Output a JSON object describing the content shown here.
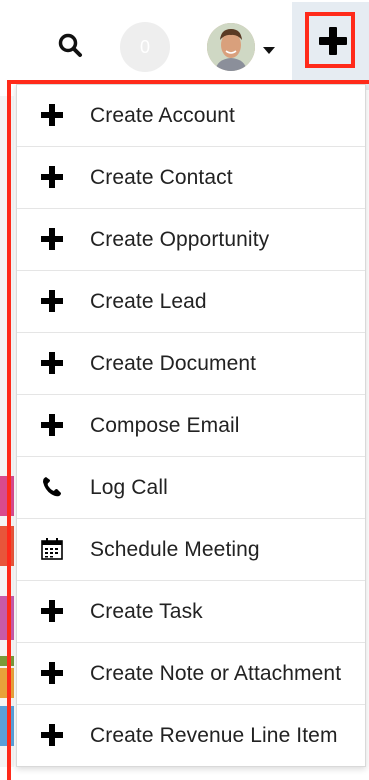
{
  "header": {
    "notification_count": "0",
    "search_icon": "search-icon",
    "avatar_icon": "user-avatar",
    "quickcreate_icon": "plus-icon"
  },
  "menu": {
    "items": [
      {
        "label": "Create Account",
        "icon": "plus-icon"
      },
      {
        "label": "Create Contact",
        "icon": "plus-icon"
      },
      {
        "label": "Create Opportunity",
        "icon": "plus-icon"
      },
      {
        "label": "Create Lead",
        "icon": "plus-icon"
      },
      {
        "label": "Create Document",
        "icon": "plus-icon"
      },
      {
        "label": "Compose Email",
        "icon": "plus-icon"
      },
      {
        "label": "Log Call",
        "icon": "phone-icon"
      },
      {
        "label": "Schedule Meeting",
        "icon": "calendar-icon"
      },
      {
        "label": "Create Task",
        "icon": "plus-icon"
      },
      {
        "label": "Create Note or Attachment",
        "icon": "plus-icon"
      },
      {
        "label": "Create Revenue Line Item",
        "icon": "plus-icon"
      }
    ]
  },
  "colors": {
    "highlight": "#ff2a1a",
    "button_active_bg": "#e6ecf2",
    "text": "#222222"
  }
}
